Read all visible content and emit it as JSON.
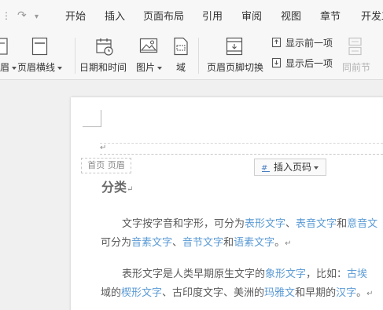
{
  "quick_access": {
    "redo_icon": "redo-icon",
    "more_icon": "chevron-down-icon"
  },
  "menu_tabs": [
    "开始",
    "插入",
    "页面布局",
    "引用",
    "审阅",
    "视图",
    "章节",
    "开发工"
  ],
  "ribbon": {
    "cut_prefix": "眉",
    "header_footer_line": "页眉横线",
    "date_time": "日期和时间",
    "picture": "图片",
    "field": "域",
    "switch_header_footer": "页眉页脚切换",
    "show_previous": "显示前一项",
    "show_next": "显示后一项",
    "same_as_previous": "同前节"
  },
  "document": {
    "header_label": "首页 页眉",
    "insert_page_number": "插入页码",
    "paragraph_mark": "↵",
    "heading": "分类",
    "p1_line1": {
      "before": "文字按字音和字形，可分为",
      "link1": "表形文字",
      "sep1": "、",
      "link2": "表音文字",
      "and": "和",
      "link3": "意音文"
    },
    "p1_line2": {
      "before": "可分为",
      "link1": "音素文字",
      "sep1": "、",
      "link2": "音节文字",
      "and": "和",
      "link3": "语素文字",
      "end": "。"
    },
    "p2_line1": {
      "before": "表形文字是人类早期原生文字的",
      "link1": "象形文字",
      "middle": "，比如：",
      "link2": "古埃"
    },
    "p2_line2": {
      "before": "域的",
      "link1": "楔形文字",
      "middle": "、古印度文字、美洲的",
      "link2": "玛雅文",
      "and": "和早期的",
      "link3": "汉字",
      "end": "。"
    }
  },
  "colors": {
    "link": "#5b9bd5",
    "text": "#5a5a5a",
    "ribbon_bg": "#f7f7f7",
    "doc_bg": "#f0f0f0"
  }
}
